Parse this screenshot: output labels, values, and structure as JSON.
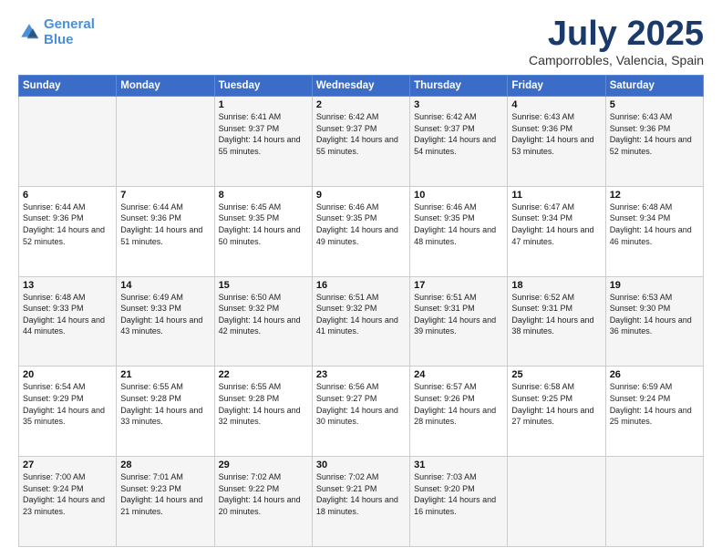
{
  "logo": {
    "line1": "General",
    "line2": "Blue"
  },
  "title": "July 2025",
  "subtitle": "Camporrobles, Valencia, Spain",
  "weekdays": [
    "Sunday",
    "Monday",
    "Tuesday",
    "Wednesday",
    "Thursday",
    "Friday",
    "Saturday"
  ],
  "weeks": [
    [
      {
        "day": "",
        "sunrise": "",
        "sunset": "",
        "daylight": ""
      },
      {
        "day": "",
        "sunrise": "",
        "sunset": "",
        "daylight": ""
      },
      {
        "day": "1",
        "sunrise": "Sunrise: 6:41 AM",
        "sunset": "Sunset: 9:37 PM",
        "daylight": "Daylight: 14 hours and 55 minutes."
      },
      {
        "day": "2",
        "sunrise": "Sunrise: 6:42 AM",
        "sunset": "Sunset: 9:37 PM",
        "daylight": "Daylight: 14 hours and 55 minutes."
      },
      {
        "day": "3",
        "sunrise": "Sunrise: 6:42 AM",
        "sunset": "Sunset: 9:37 PM",
        "daylight": "Daylight: 14 hours and 54 minutes."
      },
      {
        "day": "4",
        "sunrise": "Sunrise: 6:43 AM",
        "sunset": "Sunset: 9:36 PM",
        "daylight": "Daylight: 14 hours and 53 minutes."
      },
      {
        "day": "5",
        "sunrise": "Sunrise: 6:43 AM",
        "sunset": "Sunset: 9:36 PM",
        "daylight": "Daylight: 14 hours and 52 minutes."
      }
    ],
    [
      {
        "day": "6",
        "sunrise": "Sunrise: 6:44 AM",
        "sunset": "Sunset: 9:36 PM",
        "daylight": "Daylight: 14 hours and 52 minutes."
      },
      {
        "day": "7",
        "sunrise": "Sunrise: 6:44 AM",
        "sunset": "Sunset: 9:36 PM",
        "daylight": "Daylight: 14 hours and 51 minutes."
      },
      {
        "day": "8",
        "sunrise": "Sunrise: 6:45 AM",
        "sunset": "Sunset: 9:35 PM",
        "daylight": "Daylight: 14 hours and 50 minutes."
      },
      {
        "day": "9",
        "sunrise": "Sunrise: 6:46 AM",
        "sunset": "Sunset: 9:35 PM",
        "daylight": "Daylight: 14 hours and 49 minutes."
      },
      {
        "day": "10",
        "sunrise": "Sunrise: 6:46 AM",
        "sunset": "Sunset: 9:35 PM",
        "daylight": "Daylight: 14 hours and 48 minutes."
      },
      {
        "day": "11",
        "sunrise": "Sunrise: 6:47 AM",
        "sunset": "Sunset: 9:34 PM",
        "daylight": "Daylight: 14 hours and 47 minutes."
      },
      {
        "day": "12",
        "sunrise": "Sunrise: 6:48 AM",
        "sunset": "Sunset: 9:34 PM",
        "daylight": "Daylight: 14 hours and 46 minutes."
      }
    ],
    [
      {
        "day": "13",
        "sunrise": "Sunrise: 6:48 AM",
        "sunset": "Sunset: 9:33 PM",
        "daylight": "Daylight: 14 hours and 44 minutes."
      },
      {
        "day": "14",
        "sunrise": "Sunrise: 6:49 AM",
        "sunset": "Sunset: 9:33 PM",
        "daylight": "Daylight: 14 hours and 43 minutes."
      },
      {
        "day": "15",
        "sunrise": "Sunrise: 6:50 AM",
        "sunset": "Sunset: 9:32 PM",
        "daylight": "Daylight: 14 hours and 42 minutes."
      },
      {
        "day": "16",
        "sunrise": "Sunrise: 6:51 AM",
        "sunset": "Sunset: 9:32 PM",
        "daylight": "Daylight: 14 hours and 41 minutes."
      },
      {
        "day": "17",
        "sunrise": "Sunrise: 6:51 AM",
        "sunset": "Sunset: 9:31 PM",
        "daylight": "Daylight: 14 hours and 39 minutes."
      },
      {
        "day": "18",
        "sunrise": "Sunrise: 6:52 AM",
        "sunset": "Sunset: 9:31 PM",
        "daylight": "Daylight: 14 hours and 38 minutes."
      },
      {
        "day": "19",
        "sunrise": "Sunrise: 6:53 AM",
        "sunset": "Sunset: 9:30 PM",
        "daylight": "Daylight: 14 hours and 36 minutes."
      }
    ],
    [
      {
        "day": "20",
        "sunrise": "Sunrise: 6:54 AM",
        "sunset": "Sunset: 9:29 PM",
        "daylight": "Daylight: 14 hours and 35 minutes."
      },
      {
        "day": "21",
        "sunrise": "Sunrise: 6:55 AM",
        "sunset": "Sunset: 9:28 PM",
        "daylight": "Daylight: 14 hours and 33 minutes."
      },
      {
        "day": "22",
        "sunrise": "Sunrise: 6:55 AM",
        "sunset": "Sunset: 9:28 PM",
        "daylight": "Daylight: 14 hours and 32 minutes."
      },
      {
        "day": "23",
        "sunrise": "Sunrise: 6:56 AM",
        "sunset": "Sunset: 9:27 PM",
        "daylight": "Daylight: 14 hours and 30 minutes."
      },
      {
        "day": "24",
        "sunrise": "Sunrise: 6:57 AM",
        "sunset": "Sunset: 9:26 PM",
        "daylight": "Daylight: 14 hours and 28 minutes."
      },
      {
        "day": "25",
        "sunrise": "Sunrise: 6:58 AM",
        "sunset": "Sunset: 9:25 PM",
        "daylight": "Daylight: 14 hours and 27 minutes."
      },
      {
        "day": "26",
        "sunrise": "Sunrise: 6:59 AM",
        "sunset": "Sunset: 9:24 PM",
        "daylight": "Daylight: 14 hours and 25 minutes."
      }
    ],
    [
      {
        "day": "27",
        "sunrise": "Sunrise: 7:00 AM",
        "sunset": "Sunset: 9:24 PM",
        "daylight": "Daylight: 14 hours and 23 minutes."
      },
      {
        "day": "28",
        "sunrise": "Sunrise: 7:01 AM",
        "sunset": "Sunset: 9:23 PM",
        "daylight": "Daylight: 14 hours and 21 minutes."
      },
      {
        "day": "29",
        "sunrise": "Sunrise: 7:02 AM",
        "sunset": "Sunset: 9:22 PM",
        "daylight": "Daylight: 14 hours and 20 minutes."
      },
      {
        "day": "30",
        "sunrise": "Sunrise: 7:02 AM",
        "sunset": "Sunset: 9:21 PM",
        "daylight": "Daylight: 14 hours and 18 minutes."
      },
      {
        "day": "31",
        "sunrise": "Sunrise: 7:03 AM",
        "sunset": "Sunset: 9:20 PM",
        "daylight": "Daylight: 14 hours and 16 minutes."
      },
      {
        "day": "",
        "sunrise": "",
        "sunset": "",
        "daylight": ""
      },
      {
        "day": "",
        "sunrise": "",
        "sunset": "",
        "daylight": ""
      }
    ]
  ]
}
